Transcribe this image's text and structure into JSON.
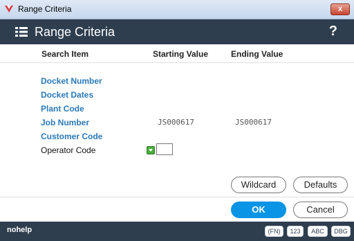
{
  "window": {
    "title": "Range Criteria",
    "close_label": "x"
  },
  "header": {
    "title": "Range Criteria",
    "help_label": "?"
  },
  "columns": {
    "search_item": "Search Item",
    "starting_value": "Starting Value",
    "ending_value": "Ending Value"
  },
  "rows": [
    {
      "label": "Docket Number",
      "start": "",
      "end": ""
    },
    {
      "label": "Docket Dates",
      "start": "",
      "end": ""
    },
    {
      "label": "Plant Code",
      "start": "",
      "end": ""
    },
    {
      "label": "Job Number",
      "start": "JS000617",
      "end": "JS000617"
    },
    {
      "label": "Customer Code",
      "start": "",
      "end": ""
    },
    {
      "label": "Operator Code",
      "start": "",
      "end": ""
    }
  ],
  "buttons": {
    "wildcard": "Wildcard",
    "defaults": "Defaults",
    "ok": "OK",
    "cancel": "Cancel"
  },
  "status": {
    "text": "nohelp",
    "badges": [
      "(FN)",
      "123",
      "ABC",
      "DBG"
    ]
  },
  "colors": {
    "header_bg": "#2f3e4f",
    "link": "#2a79b7",
    "ok_button": "#0a94e6"
  }
}
